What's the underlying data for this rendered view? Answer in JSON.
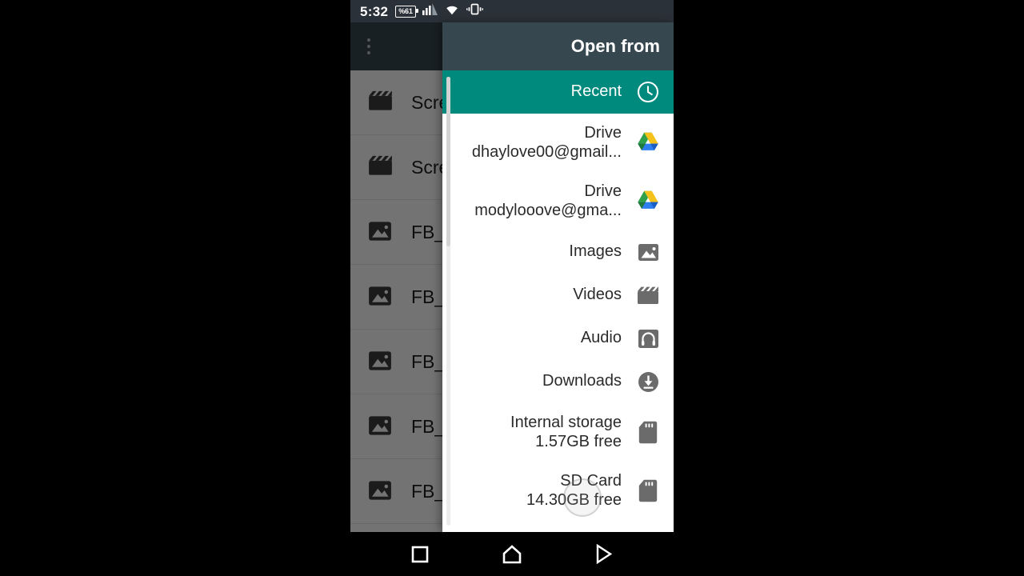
{
  "status_bar": {
    "time": "5:32",
    "battery_text": "%61",
    "icons": [
      "battery-icon",
      "signal-bars-icon",
      "wifi-icon",
      "vibrate-icon"
    ]
  },
  "background_app": {
    "overflow_menu": "overflow-menu-icon",
    "rows": [
      {
        "label": "Scree",
        "icon": "video-clapper-icon"
      },
      {
        "label": "Scree",
        "icon": "video-clapper-icon"
      },
      {
        "label": "FB_IM",
        "icon": "image-icon"
      },
      {
        "label": "FB_IM",
        "icon": "image-icon"
      },
      {
        "label": "FB_IM",
        "icon": "image-icon"
      },
      {
        "label": "FB_IM",
        "icon": "image-icon"
      },
      {
        "label": "FB_IM",
        "icon": "image-icon"
      }
    ]
  },
  "drawer": {
    "title": "Open from",
    "accent_color": "#00897d",
    "header_color": "#37474f",
    "items": [
      {
        "title": "Recent",
        "sub": "",
        "icon": "clock-icon",
        "selected": true
      },
      {
        "title": "Drive",
        "sub": "dhaylove00@gmail...",
        "icon": "google-drive-icon",
        "selected": false
      },
      {
        "title": "Drive",
        "sub": "modylooove@gma...",
        "icon": "google-drive-icon",
        "selected": false
      },
      {
        "title": "Images",
        "sub": "",
        "icon": "image-icon",
        "selected": false
      },
      {
        "title": "Videos",
        "sub": "",
        "icon": "video-clapper-icon",
        "selected": false
      },
      {
        "title": "Audio",
        "sub": "",
        "icon": "headphones-icon",
        "selected": false
      },
      {
        "title": "Downloads",
        "sub": "",
        "icon": "download-circle-icon",
        "selected": false
      },
      {
        "title": "Internal storage",
        "sub": "1.57GB free",
        "icon": "sd-card-icon",
        "selected": false
      },
      {
        "title": "SD Card",
        "sub": "14.30GB free",
        "icon": "sd-card-icon",
        "selected": false
      }
    ]
  },
  "nav_bar": {
    "buttons": [
      {
        "name": "recents-button",
        "icon": "square-icon"
      },
      {
        "name": "home-button",
        "icon": "home-icon"
      },
      {
        "name": "back-button",
        "icon": "play-triangle-icon"
      }
    ]
  }
}
